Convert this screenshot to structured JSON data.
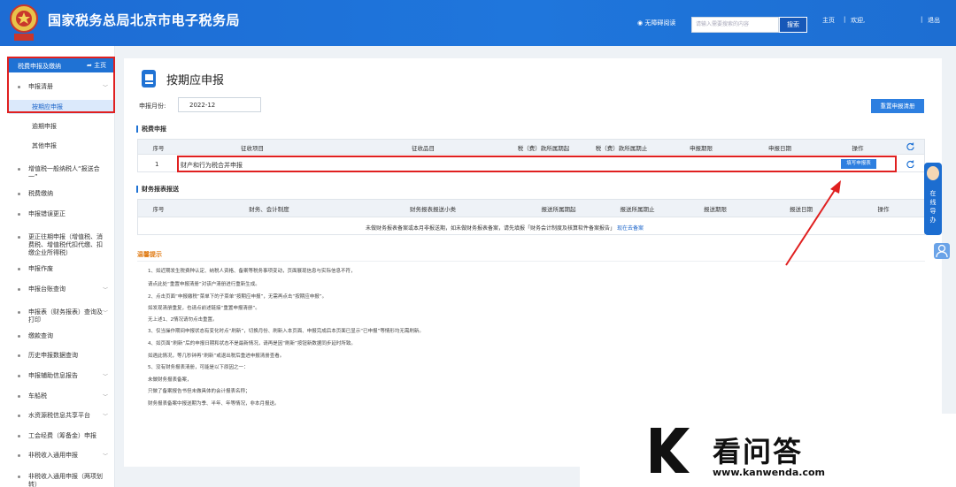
{
  "header": {
    "title": "国家税务总局北京市电子税务局",
    "accessibility": "无障碍阅读",
    "search_placeholder": "请输入需要搜索的内容",
    "search_label": "搜索",
    "home": "主页",
    "sep": "|",
    "welcome": "欢迎,",
    "logout": "退出"
  },
  "sidebar": {
    "header": "税费申报及缴纳",
    "home": "主页",
    "items": [
      {
        "label": "申报清册",
        "expand": true
      },
      {
        "label": "按期应申报",
        "active": true
      },
      {
        "label": "逾期申报"
      },
      {
        "label": "其他申报"
      },
      {
        "label": "增值税一般纳税人“报送合一”"
      },
      {
        "label": "税费缴纳"
      },
      {
        "label": "申报错误更正"
      },
      {
        "label": "更正往期申报（增值税、消费税、增值税代扣代缴、扣缴企业所得税）"
      },
      {
        "label": "申报作废"
      },
      {
        "label": "申报台账查询"
      },
      {
        "label": "申报表（财务报表）查询及打印"
      },
      {
        "label": "缴款查询"
      },
      {
        "label": "历史申报数据查询"
      },
      {
        "label": "申报辅助信息报告"
      },
      {
        "label": "车船税"
      },
      {
        "label": "水资源税信息共享平台"
      },
      {
        "label": "工会经费（筹备金）申报"
      },
      {
        "label": "非税收入通用申报"
      },
      {
        "label": "非税收入通用申报（两项划转）"
      }
    ]
  },
  "page": {
    "title": "按期应申报",
    "period_label": "申报月份:",
    "period_value": "2022-12",
    "reset_button": "重置申报清册",
    "tax_section": "税费申报",
    "tax_headers": [
      "序号",
      "征收项目",
      "征收品目",
      "税（费）款所属期起",
      "税（费）款所属期止",
      "申报期限",
      "申报日期",
      "操作"
    ],
    "tax_row": {
      "index": "1",
      "item": "财产和行为税合并申报",
      "action": "填写申报表"
    },
    "fin_section": "财务报表报送",
    "fin_headers": [
      "序号",
      "财务、会计制度",
      "财务报表报送小类",
      "报送所属期起",
      "报送所属期止",
      "报送期限",
      "报送日期",
      "操作"
    ],
    "fin_empty": "未做财务报表备案或本月非报送期，如未做财务报表备案，请先填报「财务会计制度及核算软件备案报告」",
    "fin_link": "现在去备案",
    "tips_title": "温馨提示",
    "tips": [
      "1、如近期发生税费种认定、纳税人资格、备案等税务事项变动，页面展现信息与实际信息不符，",
      "请点此处“重置申报清册”对该户清册进行重新生成。",
      "2、点击页面“申报缴税”菜单下的子菜单“按期应申报”，无需再点击“按期应申报”。",
      "如发现清册重复，也请点前述链接“重置申报清册”。",
      "无上述1、2情况请勿点击重置。",
      "3、仅当操作期间申报状态有变化时点“刷新”，切换月份、刷新入本页面、申报完成后本页面已显示“已申报”等情形均无需刷新。",
      "4、如页面“刷新”后的申报日期和状态不是最新情况，请再是因“刷新”按钮新数据同步延时所致。",
      "如遇此情况，等几秒钟再“刷新”或退出税后重进申报清册查看。",
      "5、没有财务报表清册，可能是以下原因之一：",
      "未做财务报表备案，",
      "只做了备案报告书但未做具体的会计报表名称；",
      "财务报表备案中报送期为季、半年、年等情况，非本月报送。"
    ],
    "tips_link": "现在去备案"
  },
  "float": {
    "online": "在线导办"
  },
  "watermark": {
    "brand": "看问答",
    "url": "www.kanwenda.com"
  },
  "colors": {
    "header": "#1f72d4",
    "highlight": "#e02020",
    "link": "#1a63c9",
    "tips_title": "#e07b14"
  }
}
